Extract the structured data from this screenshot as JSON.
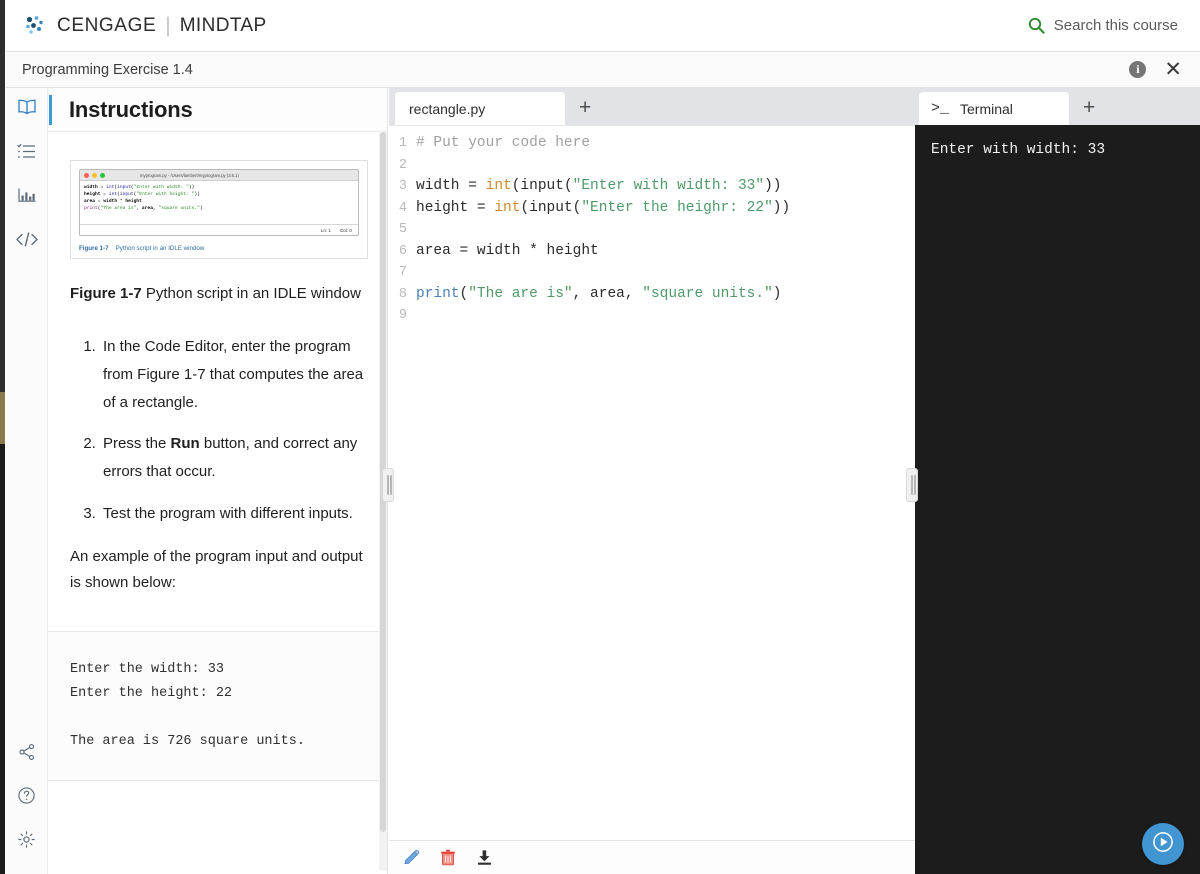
{
  "brand": {
    "logo_icon": "cengage-dots-logo",
    "name": "CENGAGE",
    "separator": "|",
    "sub": "MINDTAP",
    "search_icon": "search-icon",
    "search_label": "Search this course"
  },
  "titlebar": {
    "exercise_title": "Programming Exercise 1.4",
    "info_icon": "info-icon",
    "info_glyph": "i",
    "close_icon": "close-icon",
    "close_glyph": "✕"
  },
  "rail": {
    "items": [
      {
        "name": "book-icon",
        "label": "Book",
        "active": true
      },
      {
        "name": "list-icon",
        "label": "Assignments",
        "active": false
      },
      {
        "name": "chart-icon",
        "label": "Progress",
        "active": false
      },
      {
        "name": "code-icon",
        "label": "Code",
        "active": false
      }
    ],
    "bottom_items": [
      {
        "name": "share-icon",
        "label": "Share"
      },
      {
        "name": "help-icon",
        "label": "Help"
      },
      {
        "name": "settings-icon",
        "label": "Settings"
      }
    ]
  },
  "instructions": {
    "title": "Instructions",
    "figure": {
      "window_title": "myprogram.py - /Users/lambert/myprogram.py (3.6.1)",
      "code_lines": [
        "width = int(input(\"Enter with width: \"))",
        "height = int(input(\"Enter with height: \"))",
        "area = width * height",
        "print(\"The area is\", area, \"square units.\")"
      ],
      "status_left": "Ln: 1",
      "status_right": "Col: 0",
      "caption_label": "Figure 1-7",
      "caption_text": "Python script in an IDLE window"
    },
    "figure_label_bold": "Figure 1-7",
    "figure_label_rest": " Python script in an IDLE window",
    "steps": [
      {
        "pre": "In the Code Editor, enter the program from Figure 1-7 that computes the area of a rectangle.",
        "bold": "",
        "post": ""
      },
      {
        "pre": "Press the ",
        "bold": "Run",
        "post": " button, and correct any errors that occur."
      },
      {
        "pre": "Test the program with different inputs.",
        "bold": "",
        "post": ""
      }
    ],
    "example_note": "An example of the program input and output is shown below:",
    "example_output": "Enter the width: 33\nEnter the height: 22\n\nThe area is 726 square units."
  },
  "editor": {
    "tab_label": "rectangle.py",
    "add_tab_glyph": "+",
    "line_numbers": [
      "1",
      "2",
      "3",
      "4",
      "5",
      "6",
      "7",
      "8",
      "9"
    ],
    "code": [
      {
        "n": "1",
        "tokens": [
          {
            "t": "# Put your code here",
            "c": "cmt"
          }
        ]
      },
      {
        "n": "2",
        "tokens": []
      },
      {
        "n": "3",
        "tokens": [
          {
            "t": "width = ",
            "c": ""
          },
          {
            "t": "int",
            "c": "bi"
          },
          {
            "t": "(",
            "c": ""
          },
          {
            "t": "input",
            "c": ""
          },
          {
            "t": "(",
            "c": ""
          },
          {
            "t": "\"Enter with width: 33\"",
            "c": "str"
          },
          {
            "t": "))",
            "c": ""
          }
        ]
      },
      {
        "n": "4",
        "tokens": [
          {
            "t": "height = ",
            "c": ""
          },
          {
            "t": "int",
            "c": "bi"
          },
          {
            "t": "(",
            "c": ""
          },
          {
            "t": "input",
            "c": ""
          },
          {
            "t": "(",
            "c": ""
          },
          {
            "t": "\"Enter the heighr: 22\"",
            "c": "str"
          },
          {
            "t": "))",
            "c": ""
          }
        ]
      },
      {
        "n": "5",
        "tokens": []
      },
      {
        "n": "6",
        "tokens": [
          {
            "t": "area = width * height",
            "c": ""
          }
        ]
      },
      {
        "n": "7",
        "tokens": []
      },
      {
        "n": "8",
        "tokens": [
          {
            "t": "print",
            "c": "fnc"
          },
          {
            "t": "(",
            "c": ""
          },
          {
            "t": "\"The are is\"",
            "c": "str"
          },
          {
            "t": ", area, ",
            "c": ""
          },
          {
            "t": "\"square units.\"",
            "c": "str"
          },
          {
            "t": ")",
            "c": ""
          }
        ]
      },
      {
        "n": "9",
        "tokens": []
      }
    ],
    "toolbar": [
      {
        "name": "edit-pencil-icon",
        "label": "Edit"
      },
      {
        "name": "delete-trash-icon",
        "label": "Delete"
      },
      {
        "name": "download-icon",
        "label": "Download"
      }
    ]
  },
  "terminal": {
    "prompt_glyph": ">_",
    "tab_label": "Terminal",
    "add_tab_glyph": "+",
    "output": "Enter with width: 33"
  },
  "run_button": {
    "name": "run-button",
    "label": "Run",
    "icon": "play-icon"
  },
  "colors": {
    "accent_blue": "#3d9ad6",
    "run_blue": "#4195d1",
    "search_green": "#2e8b2e",
    "terminal_bg": "#1c1c1c",
    "caption_blue": "#2f6fa8"
  }
}
